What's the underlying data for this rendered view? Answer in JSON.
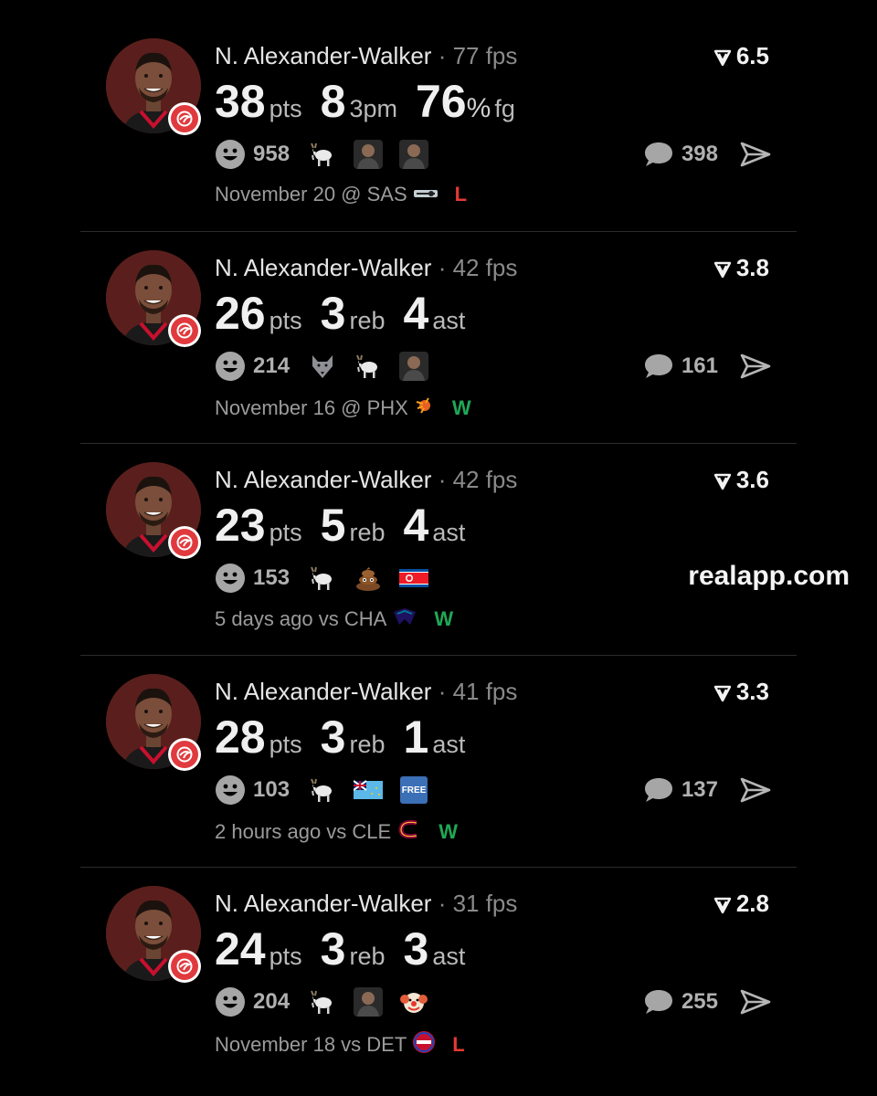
{
  "colors": {
    "background": "#000000",
    "loss": "#e53935",
    "win": "#1fa855",
    "team_primary": "#e03a3e"
  },
  "watermark": "realapp.com",
  "cards": [
    {
      "name": "N. Alexander-Walker",
      "fps": "· 77 fps",
      "score": "6.5",
      "stats": [
        {
          "value": "38",
          "label": "pts"
        },
        {
          "value": "8",
          "label": "3pm"
        },
        {
          "value": "76",
          "pct": "%",
          "label": "fg"
        }
      ],
      "reaction_count": "958",
      "reaction_emojis": [
        "goat-icon",
        "person-avatar-icon",
        "person-avatar-icon"
      ],
      "comment_count": "398",
      "date": "November 20 @ SAS",
      "opponent_logo": "spurs-logo-icon",
      "result": "L"
    },
    {
      "name": "N. Alexander-Walker",
      "fps": "· 42 fps",
      "score": "3.8",
      "stats": [
        {
          "value": "26",
          "label": "pts"
        },
        {
          "value": "3",
          "label": "reb"
        },
        {
          "value": "4",
          "label": "ast"
        }
      ],
      "reaction_count": "214",
      "reaction_emojis": [
        "wolf-icon",
        "goat-icon",
        "person-avatar-icon"
      ],
      "comment_count": "161",
      "date": "November 16 @ PHX",
      "opponent_logo": "suns-logo-icon",
      "result": "W"
    },
    {
      "name": "N. Alexander-Walker",
      "fps": "· 42 fps",
      "score": "3.6",
      "stats": [
        {
          "value": "23",
          "label": "pts"
        },
        {
          "value": "5",
          "label": "reb"
        },
        {
          "value": "4",
          "label": "ast"
        }
      ],
      "reaction_count": "153",
      "reaction_emojis": [
        "goat-icon",
        "poop-icon",
        "north-korea-flag-icon"
      ],
      "comment_count": "",
      "date": "5 days ago vs CHA",
      "opponent_logo": "hornets-logo-icon",
      "result": "W"
    },
    {
      "name": "N. Alexander-Walker",
      "fps": "· 41 fps",
      "score": "3.3",
      "stats": [
        {
          "value": "28",
          "label": "pts"
        },
        {
          "value": "3",
          "label": "reb"
        },
        {
          "value": "1",
          "label": "ast"
        }
      ],
      "reaction_count": "103",
      "reaction_emojis": [
        "goat-icon",
        "tuvalu-flag-icon",
        "free-button-icon"
      ],
      "free_badge": "FREE",
      "comment_count": "137",
      "date": "2 hours ago vs CLE",
      "opponent_logo": "cavaliers-logo-icon",
      "result": "W"
    },
    {
      "name": "N. Alexander-Walker",
      "fps": "· 31 fps",
      "score": "2.8",
      "stats": [
        {
          "value": "24",
          "label": "pts"
        },
        {
          "value": "3",
          "label": "reb"
        },
        {
          "value": "3",
          "label": "ast"
        }
      ],
      "reaction_count": "204",
      "reaction_emojis": [
        "goat-icon",
        "person-avatar-icon",
        "clown-icon"
      ],
      "comment_count": "255",
      "date": "November 18 vs DET",
      "opponent_logo": "pistons-logo-icon",
      "result": "L"
    }
  ]
}
